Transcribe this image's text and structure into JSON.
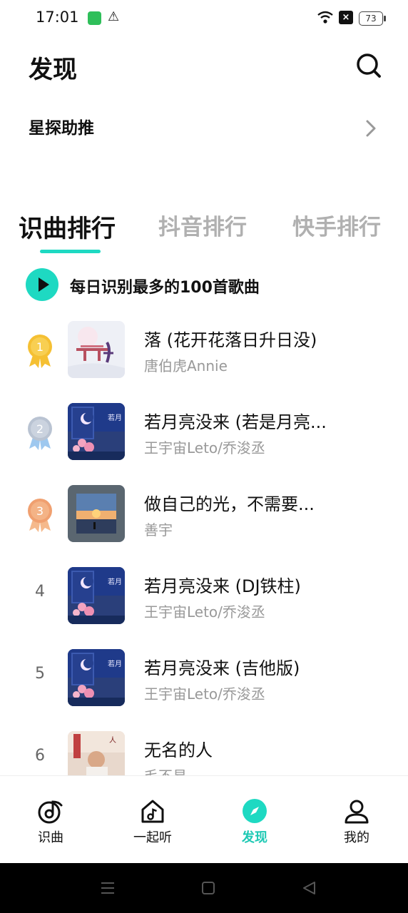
{
  "status_bar": {
    "time": "17:01",
    "battery": "73"
  },
  "header": {
    "title": "发现"
  },
  "promo": {
    "label": "星探助推"
  },
  "tabs": [
    {
      "label": "识曲排行",
      "active": true
    },
    {
      "label": "抖音排行",
      "active": false
    },
    {
      "label": "快手排行",
      "active": false
    }
  ],
  "daily": {
    "label": "每日识别最多的100首歌曲"
  },
  "songs": [
    {
      "rank": "1",
      "title": "落 (花开花落日升日没)",
      "artist": "唐伯虎Annie"
    },
    {
      "rank": "2",
      "title": "若月亮没来 (若是月亮...",
      "artist": "王宇宙Leto/乔浚丞"
    },
    {
      "rank": "3",
      "title": "做自己的光，不需要...",
      "artist": "善宇"
    },
    {
      "rank": "4",
      "title": "若月亮没来 (DJ铁柱)",
      "artist": "王宇宙Leto/乔浚丞"
    },
    {
      "rank": "5",
      "title": "若月亮没来 (吉他版)",
      "artist": "王宇宙Leto/乔浚丞"
    },
    {
      "rank": "6",
      "title": "无名的人",
      "artist": "毛不易"
    }
  ],
  "nav": [
    {
      "label": "识曲",
      "icon": "music-note-icon",
      "active": false
    },
    {
      "label": "一起听",
      "icon": "home-music-icon",
      "active": false
    },
    {
      "label": "发现",
      "icon": "compass-icon",
      "active": true
    },
    {
      "label": "我的",
      "icon": "person-icon",
      "active": false
    }
  ],
  "colors": {
    "accent": "#1ed9c2",
    "gold": "#f5c033",
    "silver": "#b9c3d2",
    "bronze": "#f0a070"
  }
}
